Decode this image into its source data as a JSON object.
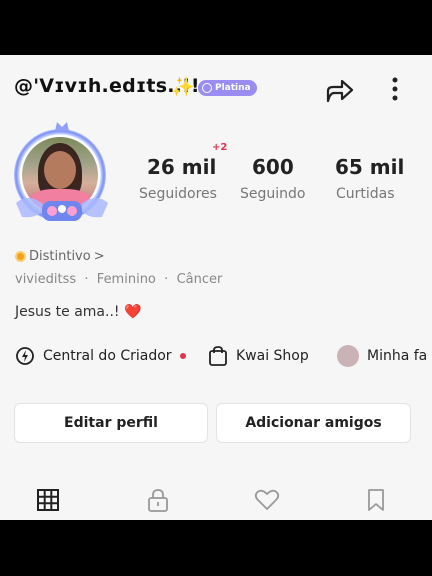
{
  "profile": {
    "username": "@'Vɪvɪh.edɪts..!!",
    "sparkle_emoji": "✨",
    "badge_label": "Platina",
    "distintivo_label": "Distintivo",
    "distintivo_arrow": ">",
    "handle": "vivieditss",
    "gender": "Feminino",
    "sign": "Câncer",
    "separator": "·",
    "bio": "Jesus te ama..!",
    "bio_emoji": "❤️"
  },
  "stats": {
    "followers_value": "26 mil",
    "followers_label": "Seguidores",
    "followers_delta": "+2",
    "following_value": "600",
    "following_label": "Seguindo",
    "likes_value": "65 mil",
    "likes_label": "Curtidas"
  },
  "shortcuts": [
    {
      "label": "Central do Criador",
      "icon": "lightning-location-icon",
      "has_dot": true
    },
    {
      "label": "Kwai Shop",
      "icon": "shopping-bag-icon"
    },
    {
      "label": "Minha fa",
      "icon": "family-avatar-icon"
    }
  ],
  "actions": {
    "edit_profile": "Editar perfil",
    "add_friends": "Adicionar amigos"
  },
  "tabs": [
    "grid-icon",
    "lock-icon",
    "heart-icon",
    "bookmark-icon"
  ],
  "colors": {
    "badge": "#9a8cf0",
    "accent_red": "#e3344f",
    "screen_bg": "#f6f6f7"
  }
}
